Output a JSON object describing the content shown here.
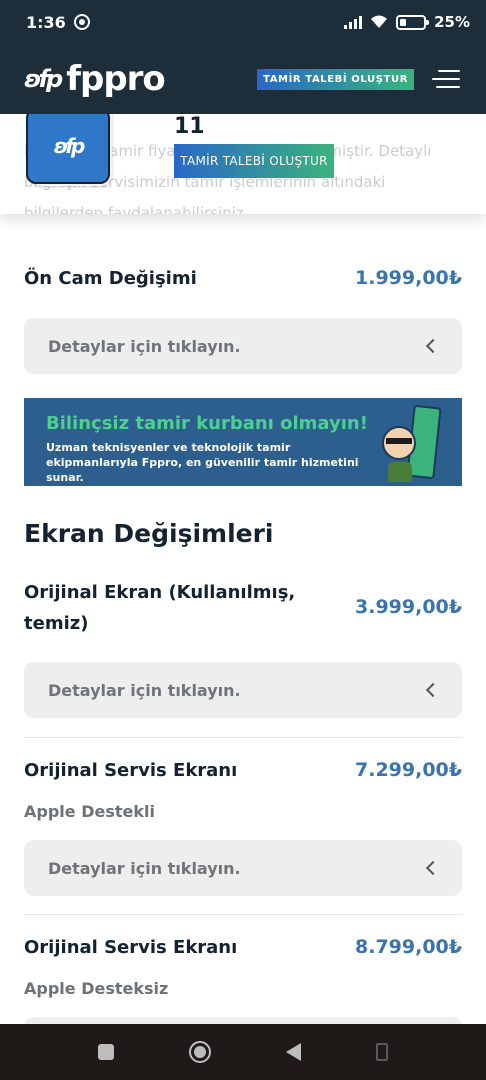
{
  "status_bar": {
    "time": "1:36",
    "battery": "25%"
  },
  "header": {
    "logo_text": "fppro",
    "cta_label": "TAMİR TALEBİ OLUŞTUR"
  },
  "product_bar": {
    "model": "11",
    "cta_label": "TAMİR TALEBİ OLUŞTUR",
    "background_text": "iPhone 11 tamir fiyatları aşağıda listelenmiştir. Detaylı bilgi için servisimizin tamir işlemlerinin altındaki bilgilerden faydalanabilirsiniz."
  },
  "items": [
    {
      "title": "Ön Cam Değişimi",
      "price": "1.999,00₺",
      "subtitle": "",
      "details_label": "Detaylar için tıklayın."
    }
  ],
  "banner": {
    "title": "Bilinçsiz tamir kurbanı olmayın!",
    "text": "Uzman teknisyenler ve teknolojik tamir ekipmanlarıyla Fppro, en güvenilir tamir hizmetini sunar."
  },
  "section": {
    "title": "Ekran Değişimleri",
    "items": [
      {
        "title": "Orijinal Ekran (Kullanılmış, temiz)",
        "price": "3.999,00₺",
        "subtitle": "",
        "details_label": "Detaylar için tıklayın."
      },
      {
        "title": "Orijinal Servis Ekranı",
        "price": "7.299,00₺",
        "subtitle": "Apple Destekli",
        "details_label": "Detaylar için tıklayın."
      },
      {
        "title": "Orijinal Servis Ekranı",
        "price": "8.799,00₺",
        "subtitle": "Apple Desteksiz",
        "details_label": ""
      }
    ]
  }
}
